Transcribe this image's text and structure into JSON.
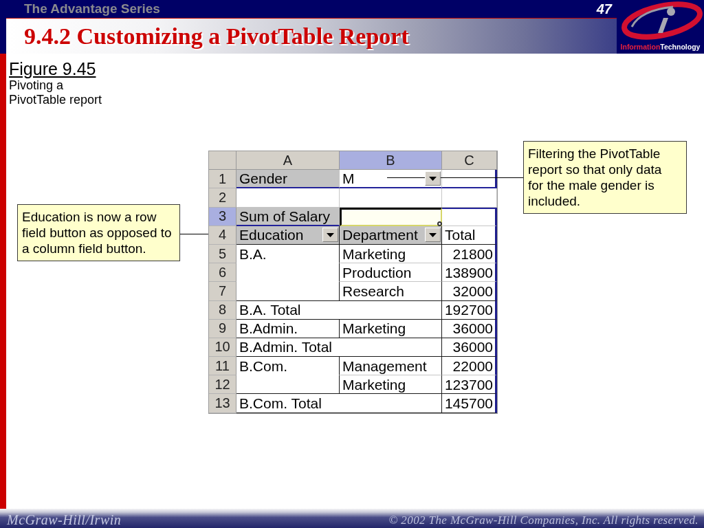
{
  "header": {
    "series": "The Advantage Series",
    "page_number": "47",
    "title": "9.4.2 Customizing a PivotTable Report",
    "logo": {
      "word_1": "Information",
      "word_2": "Technology"
    }
  },
  "figure": {
    "label": "Figure 9.45",
    "caption": "Pivoting a PivotTable report"
  },
  "callouts": [
    {
      "kind": "left",
      "text": "Education is now a row field button as opposed to a column field button."
    },
    {
      "kind": "right",
      "text": "Filtering the PivotTable report so that only data for the male gender is included."
    }
  ],
  "spreadsheet": {
    "columns": [
      {
        "label": "A",
        "selected": false
      },
      {
        "label": "B",
        "selected": true
      },
      {
        "label": "C",
        "selected": false
      }
    ],
    "rows": [
      {
        "number": "1",
        "selected": false,
        "kind": "page",
        "cells": [
          {
            "kind": "field",
            "text": "Gender",
            "selected": false
          },
          {
            "kind": "value-menu",
            "text": "M",
            "selected": false
          },
          {
            "kind": "blank",
            "selected": false
          }
        ]
      },
      {
        "number": "2",
        "selected": false,
        "kind": "spacer",
        "cells": [
          {
            "kind": "blank",
            "selected": false
          },
          {
            "kind": "blank",
            "selected": false
          },
          {
            "kind": "blank",
            "selected": false
          }
        ]
      },
      {
        "number": "3",
        "selected": true,
        "kind": "data-field",
        "cells": [
          {
            "kind": "field",
            "text": "Sum of Salary",
            "selected": false
          },
          {
            "kind": "blank",
            "selected": true
          },
          {
            "kind": "blank",
            "selected": false
          }
        ]
      },
      {
        "number": "4",
        "selected": false,
        "kind": "header",
        "cells": [
          {
            "kind": "field-menu",
            "text": "Education",
            "selected": false
          },
          {
            "kind": "field-menu",
            "text": "Department",
            "selected": false
          },
          {
            "kind": "text",
            "text": "Total",
            "selected": false
          }
        ]
      },
      {
        "number": "5",
        "selected": false,
        "kind": "group-start",
        "cells": [
          {
            "kind": "text",
            "text": "B.A.",
            "selected": false
          },
          {
            "kind": "text",
            "text": "Marketing",
            "selected": false
          },
          {
            "kind": "number",
            "text": "21800",
            "selected": false
          }
        ]
      },
      {
        "number": "6",
        "selected": false,
        "kind": "group-item",
        "cells": [
          {
            "kind": "blank",
            "selected": false
          },
          {
            "kind": "text",
            "text": "Production",
            "selected": false
          },
          {
            "kind": "number",
            "text": "138900",
            "selected": false
          }
        ]
      },
      {
        "number": "7",
        "selected": false,
        "kind": "group-item",
        "cells": [
          {
            "kind": "blank",
            "selected": false
          },
          {
            "kind": "text",
            "text": "Research",
            "selected": false
          },
          {
            "kind": "number",
            "text": "32000",
            "selected": false
          }
        ]
      },
      {
        "number": "8",
        "selected": false,
        "kind": "total",
        "cells": [
          {
            "kind": "total-label",
            "text": "B.A. Total",
            "selected": false
          },
          {
            "kind": "number",
            "text": "192700",
            "selected": false
          }
        ]
      },
      {
        "number": "9",
        "selected": false,
        "kind": "group-start",
        "cells": [
          {
            "kind": "text",
            "text": "B.Admin.",
            "selected": false
          },
          {
            "kind": "text",
            "text": "Marketing",
            "selected": false
          },
          {
            "kind": "number",
            "text": "36000",
            "selected": false
          }
        ]
      },
      {
        "number": "10",
        "selected": false,
        "kind": "total",
        "cells": [
          {
            "kind": "total-label",
            "text": "B.Admin. Total",
            "selected": false
          },
          {
            "kind": "number",
            "text": "36000",
            "selected": false
          }
        ]
      },
      {
        "number": "11",
        "selected": false,
        "kind": "group-start",
        "cells": [
          {
            "kind": "text",
            "text": "B.Com.",
            "selected": false
          },
          {
            "kind": "text",
            "text": "Management",
            "selected": false
          },
          {
            "kind": "number",
            "text": "22000",
            "selected": false
          }
        ]
      },
      {
        "number": "12",
        "selected": false,
        "kind": "group-item",
        "cells": [
          {
            "kind": "blank",
            "selected": false
          },
          {
            "kind": "text",
            "text": "Marketing",
            "selected": false
          },
          {
            "kind": "number",
            "text": "123700",
            "selected": false
          }
        ]
      },
      {
        "number": "13",
        "selected": false,
        "kind": "total",
        "cells": [
          {
            "kind": "total-label",
            "text": "B.Com. Total",
            "selected": false
          },
          {
            "kind": "number",
            "text": "145700",
            "selected": false
          }
        ]
      }
    ]
  },
  "footer": {
    "publisher": "McGraw-Hill/Irwin",
    "copyright": "© 2002 The McGraw-Hill Companies, Inc. All rights reserved."
  }
}
